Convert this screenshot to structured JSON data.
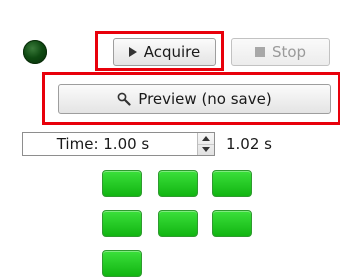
{
  "controls": {
    "acquire_label": "Acquire",
    "stop_label": "Stop",
    "preview_label": "Preview (no save)"
  },
  "time": {
    "value": "Time: 1.00 s",
    "elapsed": "1.02 s"
  },
  "status": {
    "led_color": "#0f4a12"
  },
  "cells": {
    "color": "#22c922",
    "count": 7
  },
  "icons": {
    "acquire": "play-icon",
    "stop": "stop-icon",
    "preview": "magnifier-icon",
    "spin_up": "triangle-up-icon",
    "spin_down": "triangle-down-icon"
  },
  "highlight_color": "#e8000b"
}
